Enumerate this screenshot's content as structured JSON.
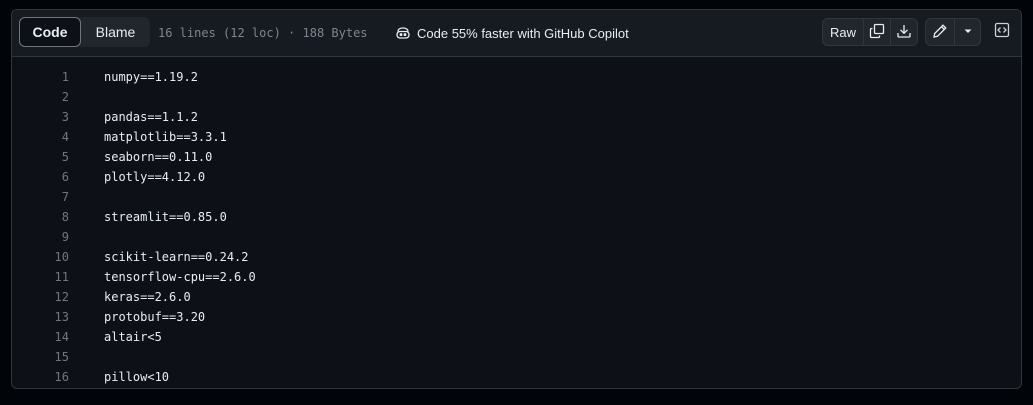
{
  "toolbar": {
    "code_tab": "Code",
    "blame_tab": "Blame",
    "file_info": "16 lines (12 loc) · 188 Bytes",
    "copilot_text": "Code 55% faster with GitHub Copilot",
    "raw_label": "Raw"
  },
  "icons": {
    "copilot": "copilot-icon",
    "copy": "copy-icon",
    "download": "download-icon",
    "edit": "pencil-icon",
    "dropdown": "triangle-down-icon",
    "symbols": "code-square-icon"
  },
  "colors": {
    "background": "#0d1117",
    "header": "#161b22",
    "border": "#30363d",
    "text": "#e6edf3",
    "muted": "#7d8590"
  },
  "lines": [
    {
      "n": "1",
      "text": "numpy==1.19.2"
    },
    {
      "n": "2",
      "text": ""
    },
    {
      "n": "3",
      "text": "pandas==1.1.2"
    },
    {
      "n": "4",
      "text": "matplotlib==3.3.1"
    },
    {
      "n": "5",
      "text": "seaborn==0.11.0"
    },
    {
      "n": "6",
      "text": "plotly==4.12.0"
    },
    {
      "n": "7",
      "text": ""
    },
    {
      "n": "8",
      "text": "streamlit==0.85.0"
    },
    {
      "n": "9",
      "text": ""
    },
    {
      "n": "10",
      "text": "scikit-learn==0.24.2"
    },
    {
      "n": "11",
      "text": "tensorflow-cpu==2.6.0"
    },
    {
      "n": "12",
      "text": "keras==2.6.0"
    },
    {
      "n": "13",
      "text": "protobuf==3.20"
    },
    {
      "n": "14",
      "text": "altair<5"
    },
    {
      "n": "15",
      "text": ""
    },
    {
      "n": "16",
      "text": "pillow<10"
    }
  ]
}
